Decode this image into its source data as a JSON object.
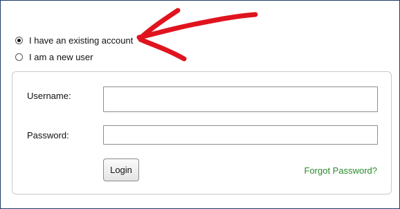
{
  "account_choice": {
    "options": [
      {
        "label": "I have an existing account",
        "selected": true
      },
      {
        "label": "I am a new user",
        "selected": false
      }
    ]
  },
  "login_form": {
    "username_label": "Username:",
    "username_value": "",
    "password_label": "Password:",
    "password_value": "",
    "login_button": "Login",
    "forgot_link": "Forgot Password?"
  },
  "annotation": {
    "arrow_color": "#e0141e",
    "points_to": "I have an existing account"
  },
  "colors": {
    "frame_border": "#1f3b66",
    "link": "#2a8a2a"
  }
}
